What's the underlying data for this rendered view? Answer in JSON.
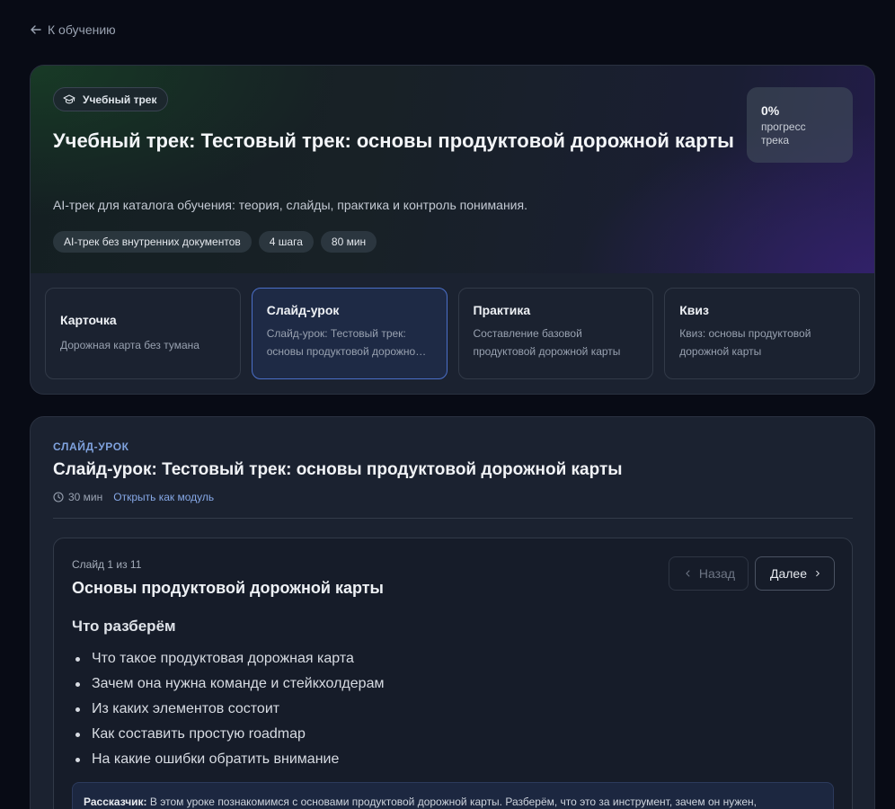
{
  "back_link": {
    "label": "К обучению"
  },
  "track": {
    "badge": "Учебный трек",
    "title": "Учебный трек: Тестовый трек: основы продуктовой дорожной карты",
    "description": "AI-трек для каталога обучения: теория, слайды, практика и контроль понимания.",
    "chips": [
      "AI-трек без внутренних документов",
      "4 шага",
      "80 мин"
    ],
    "progress": {
      "value": "0%",
      "label": "прогресс трека",
      "fraction": 0
    },
    "steps": [
      {
        "title": "Карточка",
        "subtitle": "Дорожная карта без тумана",
        "active": false
      },
      {
        "title": "Слайд-урок",
        "subtitle": "Слайд-урок: Тестовый трек: основы продуктовой дорожной карты",
        "active": true
      },
      {
        "title": "Практика",
        "subtitle": "Составление базовой продуктовой дорожной карты",
        "active": false
      },
      {
        "title": "Квиз",
        "subtitle": "Квиз: основы продуктовой дорожной карты",
        "active": false
      }
    ]
  },
  "module": {
    "kicker": "СЛАЙД-УРОК",
    "title": "Слайд-урок: Тестовый трек: основы продуктовой дорожной карты",
    "duration": "30 мин",
    "open_link": "Открыть как модуль",
    "slide": {
      "counter": "Слайд 1 из 11",
      "title": "Основы продуктовой дорожной карты",
      "prev_label": "Назад",
      "next_label": "Далее",
      "heading": "Что разберём",
      "bullets": [
        "Что такое продуктовая дорожная карта",
        "Зачем она нужна команде и стейкхолдерам",
        "Из каких элементов состоит",
        "Как составить простую roadmap",
        "На какие ошибки обратить внимание"
      ],
      "narrator_label": "Рассказчик:",
      "narrator_text": "В этом уроке познакомимся с основами продуктовой дорожной карты. Разберём, что это за инструмент, зачем он нужен,"
    }
  }
}
